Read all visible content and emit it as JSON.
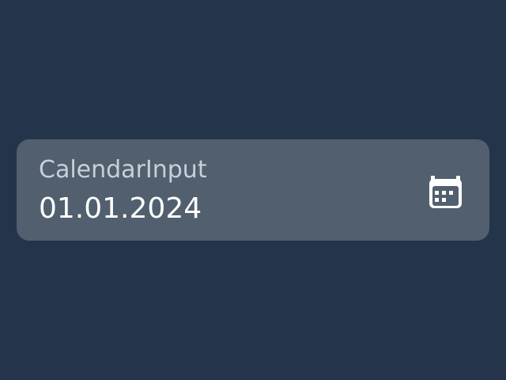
{
  "calendar_input": {
    "label": "CalendarInput",
    "value": "01.01.2024",
    "icon": "calendar-icon"
  },
  "colors": {
    "background": "#24354b",
    "field_background": "#525f6e",
    "label": "#c8d0d9",
    "value": "#ffffff",
    "icon": "#ffffff"
  }
}
